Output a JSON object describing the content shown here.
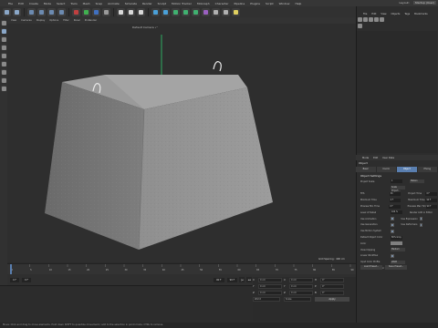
{
  "menubar": {
    "items": [
      "File",
      "Edit",
      "Create",
      "Mode",
      "Select",
      "Tools",
      "Mesh",
      "Snap",
      "Animate",
      "Simulate",
      "Render",
      "Sculpt",
      "Motion Tracker",
      "MoGraph",
      "Character",
      "Pipeline",
      "Plugins",
      "Script",
      "Window",
      "Help"
    ],
    "layout_label": "Layout:",
    "layout_value": "Startup (User)"
  },
  "viewport": {
    "menu": [
      "View",
      "Cameras",
      "Display",
      "Options",
      "Filter",
      "Panel",
      "ProRender"
    ],
    "camera_label": "Default Camera •°",
    "grid_spacing": "Grid Spacing : 400 cm"
  },
  "object_manager": {
    "menu": [
      "File",
      "Edit",
      "View",
      "Objects",
      "Tags",
      "Bookmarks"
    ]
  },
  "attributes": {
    "menu": [
      "Mode",
      "Edit",
      "User Data"
    ],
    "object_name": "Object",
    "tabs": [
      "Basic",
      "Coord.",
      "Object",
      "Phong"
    ],
    "active_tab": 2,
    "section": "Object Settings",
    "rows": [
      {
        "label": "Project Scale",
        "value": "1",
        "right_label": "",
        "right_value": "Meters"
      },
      {
        "label": "",
        "value": "Scale Project...",
        "right_label": "",
        "right_value": ""
      },
      {
        "label": "FPS",
        "value": "30",
        "right_label": "Project Time",
        "right_value": "0 F"
      },
      {
        "label": "Minimum Time",
        "value": "0 F",
        "right_label": "Maximum Time",
        "right_value": "90 F"
      },
      {
        "label": "Preview Min Time",
        "value": "0 F",
        "right_label": "Preview Max Time",
        "right_value": "90 F"
      },
      {
        "label": "Level of Detail",
        "value": "100 %",
        "right_label": "Render LOD in Editor",
        "right_value": ""
      },
      {
        "label": "Use Animation",
        "value": "check",
        "right_label": "Use Expression",
        "right_value": "check"
      },
      {
        "label": "Use Generators",
        "value": "check",
        "right_label": "Use Deformers",
        "right_value": "check"
      },
      {
        "label": "Use Motion System",
        "value": "check",
        "right_label": "",
        "right_value": ""
      },
      {
        "label": "Default Object Color",
        "value": "80% Gray",
        "right_label": "",
        "right_value": ""
      },
      {
        "label": "Color",
        "value": "",
        "right_label": "",
        "right_value": ""
      },
      {
        "label": "View Clipping",
        "value": "Medium",
        "right_label": "",
        "right_value": ""
      },
      {
        "label": "Linear Workflow",
        "value": "check",
        "right_label": "",
        "right_value": ""
      },
      {
        "label": "Input Color Profile",
        "value": "sRGB",
        "right_label": "",
        "right_value": ""
      },
      {
        "label": "Use Color Channel for Node Material",
        "value": "check",
        "right_label": "",
        "right_value": ""
      }
    ],
    "buttons": [
      "Load Preset...",
      "Save Preset..."
    ]
  },
  "timeline": {
    "ticks": [
      "0",
      "5",
      "10",
      "15",
      "20",
      "25",
      "30",
      "35",
      "40",
      "45",
      "50",
      "55",
      "60",
      "65",
      "70",
      "75",
      "80",
      "85",
      "90"
    ],
    "frame_start": "0 F",
    "frame_current": "0 F",
    "frame_end": "90 F",
    "frame_end2": "90 F",
    "frame_display": "0 F"
  },
  "coordinates": {
    "labels": [
      "X",
      "Y",
      "Z"
    ],
    "values": [
      "0 cm",
      "0 cm",
      "0 cm"
    ],
    "scale_values": [
      "0 cm",
      "0 cm",
      "0 cm"
    ],
    "rotation_labels": [
      "H",
      "P",
      "B"
    ],
    "rotation_values": [
      "0°",
      "0°",
      "0°"
    ],
    "mode1": "World",
    "mode2": "Scale",
    "apply": "Apply"
  },
  "statusbar": {
    "text": "Move: Click and drag to move elements. Hold down SHIFT to quantize movement / add to the selection in point mode. CTRL to remove."
  },
  "colors": {
    "accent": "#5a7fb0",
    "record": "#c83232",
    "y_axis": "#2ecc71"
  }
}
